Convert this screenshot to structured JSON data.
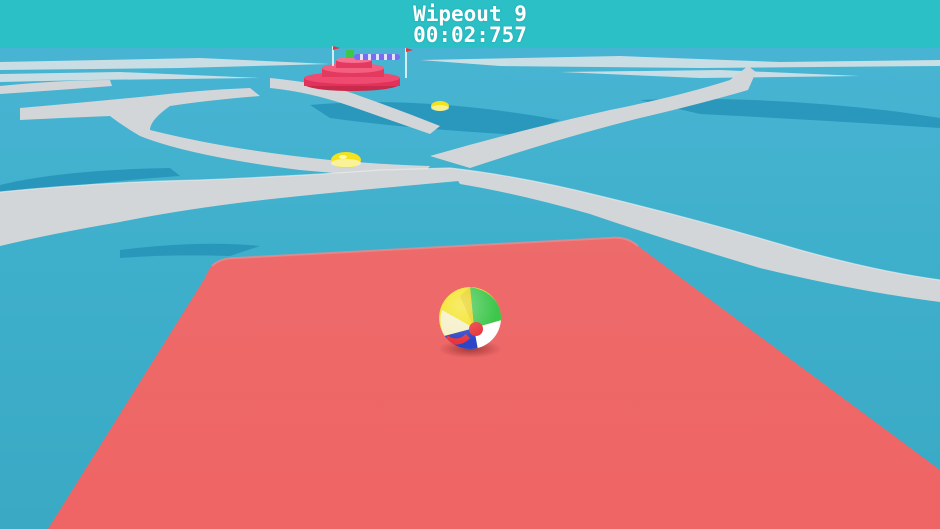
{
  "hud": {
    "level_name": "Wipeout 9",
    "timer": "00:02:757"
  },
  "colors": {
    "sky": "#2bbfc6",
    "water": "#3aabc6",
    "water_dark": "#1f8db3",
    "path": "#d0d4d6",
    "platform": "#ec6363",
    "ball_yellow": "#f3e21c",
    "ball_green": "#3cc64a",
    "ball_red": "#e8343a",
    "ball_blue": "#2b46c8"
  },
  "scene_objects": {
    "player": "beach-ball",
    "platform": "red-start-platform",
    "goal": "goal-platform-with-flags",
    "collectibles": "yellow-gems"
  }
}
